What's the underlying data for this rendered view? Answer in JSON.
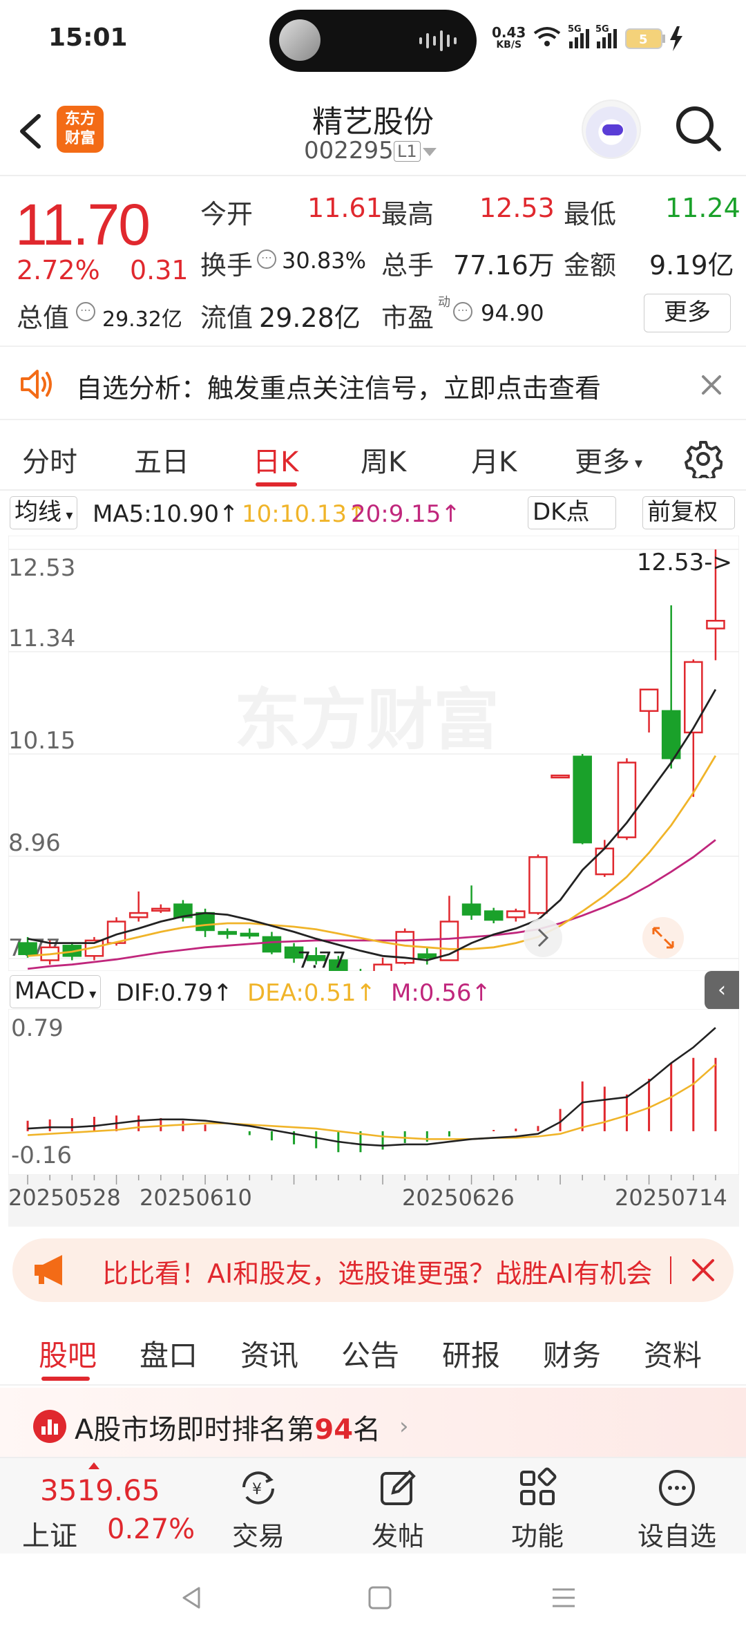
{
  "status_bar": {
    "time": "15:01",
    "net_speed_value": "0.43",
    "net_speed_unit": "KB/S",
    "signal_label_1": "5G",
    "signal_label_2": "5G",
    "battery": "5"
  },
  "header": {
    "logo_text": "东方财富",
    "stock_name": "精艺股份",
    "stock_code": "002295",
    "level_badge": "L1"
  },
  "quote": {
    "price": "11.70",
    "change_pct": "2.72%",
    "change_val": "0.31",
    "market_cap_label": "总值",
    "market_cap": "29.32亿",
    "fields": [
      {
        "label": "今开",
        "value": "11.61",
        "color": "red"
      },
      {
        "label": "最高",
        "value": "12.53",
        "color": "red"
      },
      {
        "label": "最低",
        "value": "11.24",
        "color": "green"
      },
      {
        "label": "换手",
        "value": "30.83%",
        "color": "black"
      },
      {
        "label": "总手",
        "value": "77.16万",
        "color": "black"
      },
      {
        "label": "金额",
        "value": "9.19亿",
        "color": "black"
      },
      {
        "label": "流值",
        "value": "29.28亿",
        "color": "black"
      },
      {
        "label": "市盈",
        "value": "94.90",
        "color": "black"
      }
    ],
    "pe_superscript": "动",
    "more_button": "更多"
  },
  "notice": {
    "text": "自选分析：触发重点关注信号，立即点击查看"
  },
  "tabs": [
    "分时",
    "五日",
    "日K",
    "周K",
    "月K",
    "更多"
  ],
  "active_tab": "日K",
  "ma_bar": {
    "selector": "均线",
    "ma5": "MA5:10.90↑",
    "ma10": "10:10.13↑",
    "ma20": "20:9.15↑",
    "dk_button": "DK点",
    "adjust_button": "前复权"
  },
  "colors": {
    "up": "#e0282e",
    "down": "#1aa12a",
    "ma5": "#222222",
    "ma10": "#f0b429",
    "ma20": "#c0267c",
    "accent": "#e0282e"
  },
  "chart_data": [
    {
      "type": "candlestick",
      "y_ticks": [
        "12.53",
        "11.34",
        "10.15",
        "8.96",
        "7.77"
      ],
      "ylim": [
        7.77,
        12.53
      ],
      "max_label": "12.53->",
      "min_label": "7.77",
      "watermark": "东方财富",
      "candles": [
        {
          "o": 7.95,
          "c": 7.82,
          "h": 8.02,
          "l": 7.78
        },
        {
          "o": 7.75,
          "c": 7.9,
          "h": 7.98,
          "l": 7.7
        },
        {
          "o": 7.92,
          "c": 7.8,
          "h": 7.96,
          "l": 7.75
        },
        {
          "o": 7.8,
          "c": 7.98,
          "h": 8.02,
          "l": 7.75
        },
        {
          "o": 7.95,
          "c": 8.2,
          "h": 8.25,
          "l": 7.92
        },
        {
          "o": 8.25,
          "c": 8.3,
          "h": 8.55,
          "l": 8.2
        },
        {
          "o": 8.35,
          "c": 8.35,
          "h": 8.4,
          "l": 8.3
        },
        {
          "o": 8.4,
          "c": 8.25,
          "h": 8.45,
          "l": 8.2
        },
        {
          "o": 8.3,
          "c": 8.1,
          "h": 8.35,
          "l": 8.02
        },
        {
          "o": 8.08,
          "c": 8.06,
          "h": 8.12,
          "l": 8.0
        },
        {
          "o": 8.06,
          "c": 8.05,
          "h": 8.12,
          "l": 8.0
        },
        {
          "o": 8.02,
          "c": 7.85,
          "h": 8.08,
          "l": 7.82
        },
        {
          "o": 7.9,
          "c": 7.78,
          "h": 7.95,
          "l": 7.72
        },
        {
          "o": 7.8,
          "c": 7.75,
          "h": 7.9,
          "l": 7.7
        },
        {
          "o": 7.75,
          "c": 7.6,
          "h": 7.8,
          "l": 7.55
        },
        {
          "o": 7.6,
          "c": 7.58,
          "h": 7.65,
          "l": 7.5
        },
        {
          "o": 7.55,
          "c": 7.7,
          "h": 7.78,
          "l": 7.5
        },
        {
          "o": 7.72,
          "c": 8.08,
          "h": 8.12,
          "l": 7.7
        },
        {
          "o": 7.82,
          "c": 7.78,
          "h": 7.9,
          "l": 7.7
        },
        {
          "o": 7.75,
          "c": 8.2,
          "h": 8.5,
          "l": 7.75
        },
        {
          "o": 8.4,
          "c": 8.28,
          "h": 8.62,
          "l": 8.22
        },
        {
          "o": 8.32,
          "c": 8.22,
          "h": 8.36,
          "l": 8.18
        },
        {
          "o": 8.25,
          "c": 8.32,
          "h": 8.35,
          "l": 8.2
        },
        {
          "o": 8.3,
          "c": 8.95,
          "h": 8.98,
          "l": 8.28
        },
        {
          "o": 9.9,
          "c": 9.9,
          "h": 9.9,
          "l": 9.9
        },
        {
          "o": 10.12,
          "c": 9.12,
          "h": 10.15,
          "l": 9.1
        },
        {
          "o": 8.75,
          "c": 9.05,
          "h": 9.15,
          "l": 8.72
        },
        {
          "o": 9.18,
          "c": 10.05,
          "h": 10.1,
          "l": 9.15
        },
        {
          "o": 10.65,
          "c": 10.9,
          "h": 10.9,
          "l": 10.4
        },
        {
          "o": 10.65,
          "c": 10.1,
          "h": 11.88,
          "l": 9.98
        },
        {
          "o": 10.4,
          "c": 11.22,
          "h": 11.25,
          "l": 9.65
        },
        {
          "o": 11.61,
          "c": 11.7,
          "h": 12.53,
          "l": 11.24
        }
      ],
      "ma5": [
        8.0,
        7.95,
        7.95,
        7.95,
        8.05,
        8.12,
        8.2,
        8.26,
        8.3,
        8.28,
        8.22,
        8.15,
        8.08,
        8.0,
        7.93,
        7.86,
        7.8,
        7.78,
        7.75,
        7.82,
        7.95,
        8.05,
        8.12,
        8.22,
        8.45,
        8.8,
        9.05,
        9.35,
        9.7,
        10.05,
        10.45,
        10.9
      ],
      "ma10": [
        7.8,
        7.82,
        7.85,
        7.9,
        7.96,
        8.02,
        8.08,
        8.13,
        8.16,
        8.18,
        8.18,
        8.16,
        8.14,
        8.11,
        8.06,
        8.01,
        7.96,
        7.92,
        7.9,
        7.88,
        7.88,
        7.9,
        7.95,
        8.02,
        8.15,
        8.32,
        8.5,
        8.72,
        9.0,
        9.32,
        9.7,
        10.13
      ],
      "ma20": [
        7.65,
        7.68,
        7.7,
        7.73,
        7.76,
        7.8,
        7.84,
        7.87,
        7.9,
        7.92,
        7.94,
        7.96,
        7.97,
        7.98,
        7.98,
        7.98,
        7.98,
        7.98,
        7.99,
        8.0,
        8.02,
        8.04,
        8.07,
        8.11,
        8.18,
        8.27,
        8.37,
        8.48,
        8.62,
        8.78,
        8.95,
        9.15
      ]
    },
    {
      "type": "macd",
      "selector": "MACD",
      "dif_label": "DIF:0.79↑",
      "dea_label": "DEA:0.51↑",
      "m_label": "M:0.56↑",
      "y_ticks": [
        "0.79",
        "-0.16"
      ],
      "ylim": [
        -0.28,
        0.88
      ],
      "dif": [
        0.02,
        0.03,
        0.03,
        0.04,
        0.06,
        0.08,
        0.09,
        0.09,
        0.08,
        0.06,
        0.04,
        0.01,
        -0.02,
        -0.05,
        -0.08,
        -0.1,
        -0.11,
        -0.1,
        -0.1,
        -0.08,
        -0.06,
        -0.05,
        -0.04,
        -0.02,
        0.07,
        0.22,
        0.24,
        0.26,
        0.38,
        0.52,
        0.64,
        0.79
      ],
      "dea": [
        -0.03,
        -0.02,
        -0.01,
        0.0,
        0.01,
        0.03,
        0.04,
        0.05,
        0.06,
        0.06,
        0.05,
        0.04,
        0.03,
        0.02,
        0.0,
        -0.02,
        -0.04,
        -0.05,
        -0.06,
        -0.06,
        -0.06,
        -0.05,
        -0.05,
        -0.04,
        -0.02,
        0.03,
        0.07,
        0.12,
        0.18,
        0.26,
        0.36,
        0.51
      ],
      "m": [
        0.08,
        0.09,
        0.1,
        0.11,
        0.12,
        0.12,
        0.1,
        0.08,
        0.05,
        0.0,
        -0.03,
        -0.07,
        -0.1,
        -0.13,
        -0.16,
        -0.16,
        -0.14,
        -0.09,
        -0.08,
        -0.04,
        0.0,
        0.01,
        0.02,
        0.04,
        0.17,
        0.38,
        0.34,
        0.28,
        0.4,
        0.52,
        0.56,
        0.56
      ],
      "x_labels": [
        "20250528",
        "20250610",
        "20250626",
        "20250714"
      ]
    }
  ],
  "ai_banner": {
    "text": "比比看！AI和股友，选股谁更强？战胜AI有机会"
  },
  "bottom_tabs": [
    "股吧",
    "盘口",
    "资讯",
    "公告",
    "研报",
    "财务",
    "资料"
  ],
  "ranking": {
    "prefix": "A股市场即时排名第",
    "rank": "94",
    "suffix": "名"
  },
  "bottom_nav": {
    "index_value": "3519.65",
    "index_name": "上证",
    "index_change": "0.27%",
    "items": [
      "交易",
      "发帖",
      "功能",
      "设自选"
    ]
  }
}
